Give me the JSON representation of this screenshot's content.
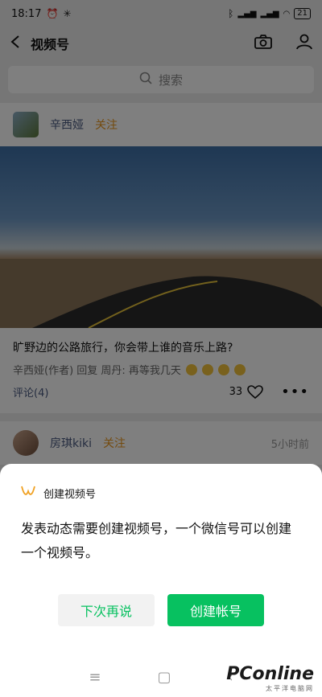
{
  "status_bar": {
    "time": "18:17",
    "battery": "21"
  },
  "nav": {
    "title": "视频号"
  },
  "search": {
    "placeholder": "搜索"
  },
  "posts": [
    {
      "author": "辛西娅",
      "follow": "关注",
      "title": "旷野边的公路旅行，你会带上谁的音乐上路?",
      "comment": "辛西娅(作者) 回复 周丹: 再等我几天",
      "comments_label": "评论(4)",
      "likes": "33"
    },
    {
      "author": "房琪kiki",
      "follow": "关注",
      "time": "5小时前"
    }
  ],
  "sheet": {
    "title": "创建视频号",
    "body": "发表动态需要创建视频号，一个微信号可以创建一个视频号。",
    "cancel_label": "下次再说",
    "confirm_label": "创建帐号"
  },
  "watermark": {
    "main": "PConline",
    "sub": "太平洋电脑网"
  },
  "colors": {
    "accent": "#07c160",
    "follow": "#e8961f",
    "link": "#4a5a80"
  }
}
